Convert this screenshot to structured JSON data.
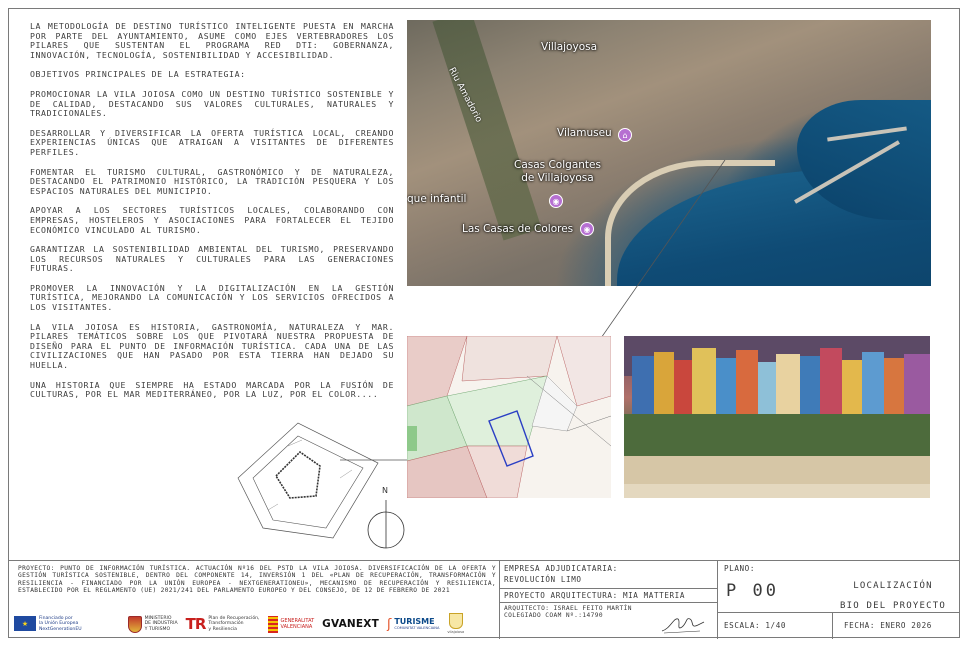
{
  "intro": {
    "paragraphs": [
      "La metodología de Destino Turístico Inteligente puesta en marcha por parte del ayuntamiento, asume como ejes vertebradores los pilares que sustentan el programa RED DTI: gobernanza, innovación, tecnología, sostenibilidad y accesibilidad.",
      "Objetivos principales de la estrategia:",
      "Promocionar La Vila Joiosa como un destino turístico sostenible y de calidad, destacando sus valores culturales, naturales y tradicionales.",
      "Desarrollar y diversificar la oferta turística local, creando experiencias únicas que atraigan a visitantes de diferentes perfiles.",
      "Fomentar el turismo cultural, gastronómico y de naturaleza, destacando el patrimonio histórico, la tradición pesquera y los espacios naturales del municipio.",
      "Apoyar a los sectores turísticos locales, colaborando con empresas, hosteleros y asociaciones para fortalecer el tejido económico vinculado al turismo.",
      "Garantizar la sostenibilidad ambiental del turismo, preservando los recursos naturales y culturales para las generaciones futuras.",
      "Promover la innovación y la digitalización en la gestión turística, mejorando la comunicación y los servicios ofrecidos a los visitantes.",
      "La Vila Joiosa es historia, gastronomía, naturaleza y mar. Pilares temáticos sobre los que pivotará nuestra propuesta de diseño para el punto de información turística. Cada una de las civilizaciones que han pasado por esta tierra han dejado su huella.",
      "Una historia que siempre ha estado marcada por la fusión de culturas, por el mar mediterráneo, por la luz, por el color...."
    ]
  },
  "aerial_map": {
    "labels": {
      "town": "Villajoyosa",
      "river": "Riu Amadorio",
      "museum": "Vilamuseu",
      "hanging_houses": "Casas Colgantes\nde Villajoyosa",
      "park": "que infantil",
      "colored_houses": "Las Casas de Colores"
    }
  },
  "site_plan": {
    "north_label": "N"
  },
  "title_block": {
    "project_label": "Proyecto:",
    "project_description": "Punto de información turística. Actuación Nº16 del PSTD La Vila Joiosa. Diversificación de la oferta y gestión turística sostenible, dentro del Componente 14, Inversión 1 del «Plan de Recuperación, Transformación y Resiliencia - financiado por la Unión Europea - NextGenerationEU», mecanismo de Recuperación y Resiliencia, establecido por el Reglamento (UE) 2021/241 del Parlamento Europeo y del Consejo, de 12 de febrero de 2021",
    "logos": {
      "eu_line1": "Financiado por",
      "eu_line2": "la Unión Europea",
      "eu_line3": "NextGenerationEU",
      "ministry_line1": "MINISTERIO",
      "ministry_line2": "DE INDUSTRIA",
      "ministry_line3": "Y TURISMO",
      "prtr_line1": "Plan de Recuperación,",
      "prtr_line2": "Transformación",
      "prtr_line3": "y Resiliencia",
      "gv_line1": "GENERALITAT",
      "gv_line2": "VALENCIANA",
      "gva_next": "GVANEXT",
      "turisme": "TURISME",
      "turisme_sub": "COMUNITAT VALENCIANA",
      "vila_joiosa": "vilajoiosa"
    },
    "company_label": "Empresa adjudicataria:",
    "company_name": "Revolución Limo",
    "architecture_label": "Proyecto arquitectura: Mia Matteria",
    "architect": "Arquitecto: Israel Feito Martín",
    "colegiado": "Colegiado COAM Nº.:14790",
    "plano_label": "Plano:",
    "plano_number": "P 00",
    "plano_title": "Localización",
    "plano_subtitle": "BIO del proyecto",
    "escala": "Escala: 1/40",
    "fecha": "Fecha: Enero 2026"
  }
}
